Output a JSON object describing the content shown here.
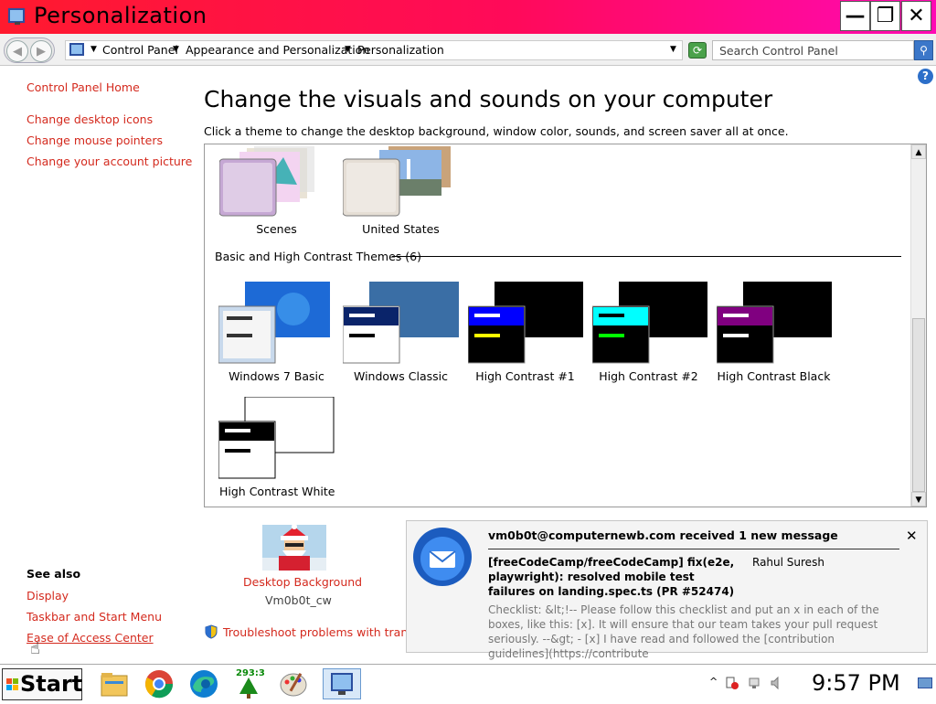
{
  "window": {
    "title": "Personalization",
    "minimize_glyph": "—",
    "restore_glyph": "❐",
    "close_glyph": "✕"
  },
  "address": {
    "crumbs": [
      "Control Panel",
      "Appearance and Personalization",
      "Personalization"
    ],
    "search_placeholder": "Search Control Panel"
  },
  "sidebar": {
    "home": "Control Panel Home",
    "links": [
      "Change desktop icons",
      "Change mouse pointers",
      "Change your account picture"
    ],
    "see_also_title": "See also",
    "see_also": [
      "Display",
      "Taskbar and Start Menu",
      "Ease of Access Center"
    ]
  },
  "main": {
    "heading": "Change the visuals and sounds on your computer",
    "subtitle": "Click a theme to change the desktop background, window color, sounds, and screen saver all at once.",
    "aero_themes": [
      "Scenes",
      "United States"
    ],
    "basic_group": "Basic and High Contrast Themes (6)",
    "basic_themes": [
      "Windows 7 Basic",
      "Windows Classic",
      "High Contrast #1",
      "High Contrast #2",
      "High Contrast Black",
      "High Contrast White"
    ],
    "desktop_background_label": "Desktop Background",
    "desktop_background_value": "Vm0b0t_cw",
    "troubleshoot": "Troubleshoot problems with transpare"
  },
  "notification": {
    "title": "vm0b0t@computernewb.com received 1 new message",
    "subject": "[freeCodeCamp/freeCodeCamp] fix(e2e, playwright): resolved mobile test failures on landing.spec.ts (PR #52474)",
    "sender": "Rahul Suresh",
    "body": "Checklist: &lt;!-- Please follow this checklist and put an x in each of the boxes, like this: [x]. It will ensure that our team takes your pull request seriously. --&gt; - [x] I have read and followed the [contribution guidelines](https://contribute"
  },
  "taskbar": {
    "start_label": "Start",
    "tray_badge": "293:3",
    "clock": "9:57 PM"
  },
  "colors": {
    "title_start": "#ff1a2e",
    "title_end": "#ff0ab4",
    "link": "#d42a1e"
  }
}
